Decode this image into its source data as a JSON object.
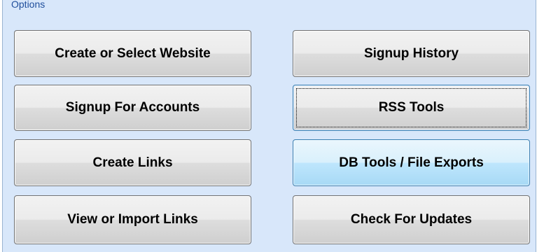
{
  "group": {
    "title": "Options"
  },
  "buttons": {
    "create_select_website": "Create or Select Website",
    "signup_history": "Signup History",
    "signup_accounts": "Signup For Accounts",
    "rss_tools": "RSS Tools",
    "create_links": "Create Links",
    "db_tools": "DB Tools / File Exports",
    "view_import_links": "View or Import Links",
    "check_updates": "Check For Updates"
  },
  "state": {
    "focused_button": "RSS Tools",
    "hovered_button": "DB Tools / File Exports"
  },
  "colors": {
    "group_background": "#d8e7fa",
    "header_text": "#1f4e9c",
    "hover_accent": "#a7d9f5"
  }
}
